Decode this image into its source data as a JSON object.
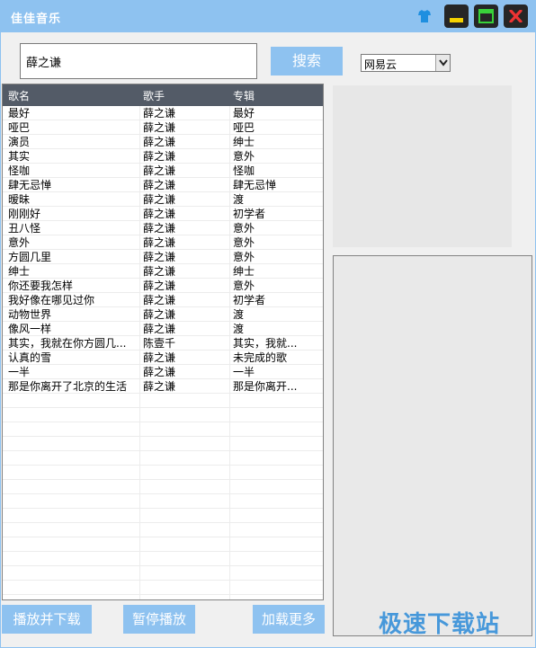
{
  "app": {
    "title": "佳佳音乐"
  },
  "search": {
    "value": "薛之谦",
    "button_label": "搜索"
  },
  "source": {
    "selected": "网易云"
  },
  "table": {
    "headers": [
      "歌名",
      "歌手",
      "专辑"
    ],
    "rows": [
      [
        "最好",
        "薛之谦",
        "最好"
      ],
      [
        "哑巴",
        "薛之谦",
        "哑巴"
      ],
      [
        "演员",
        "薛之谦",
        "绅士"
      ],
      [
        "其实",
        "薛之谦",
        "意外"
      ],
      [
        "怪咖",
        "薛之谦",
        "怪咖"
      ],
      [
        "肆无忌惮",
        "薛之谦",
        "肆无忌惮"
      ],
      [
        "暧昧",
        "薛之谦",
        "渡"
      ],
      [
        "刚刚好",
        "薛之谦",
        "初学者"
      ],
      [
        "丑八怪",
        "薛之谦",
        "意外"
      ],
      [
        "意外",
        "薛之谦",
        "意外"
      ],
      [
        "方圆几里",
        "薛之谦",
        "意外"
      ],
      [
        "绅士",
        "薛之谦",
        "绅士"
      ],
      [
        "你还要我怎样",
        "薛之谦",
        "意外"
      ],
      [
        "我好像在哪见过你",
        "薛之谦",
        "初学者"
      ],
      [
        "动物世界",
        "薛之谦",
        "渡"
      ],
      [
        "像风一样",
        "薛之谦",
        "渡"
      ],
      [
        "其实，我就在你方圆几...",
        "陈壹千",
        "其实，我就..."
      ],
      [
        "认真的雪",
        "薛之谦",
        "未完成的歌"
      ],
      [
        "一半",
        "薛之谦",
        "一半"
      ],
      [
        "那是你离开了北京的生活",
        "薛之谦",
        "那是你离开..."
      ]
    ]
  },
  "buttons": {
    "play_download": "播放并下载",
    "pause": "暂停播放",
    "load_more": "加载更多"
  },
  "watermark": "极速下载站",
  "colors": {
    "accent": "#8ec2f0",
    "header_bg": "#535b67",
    "watermark": "#2b8ad8"
  }
}
